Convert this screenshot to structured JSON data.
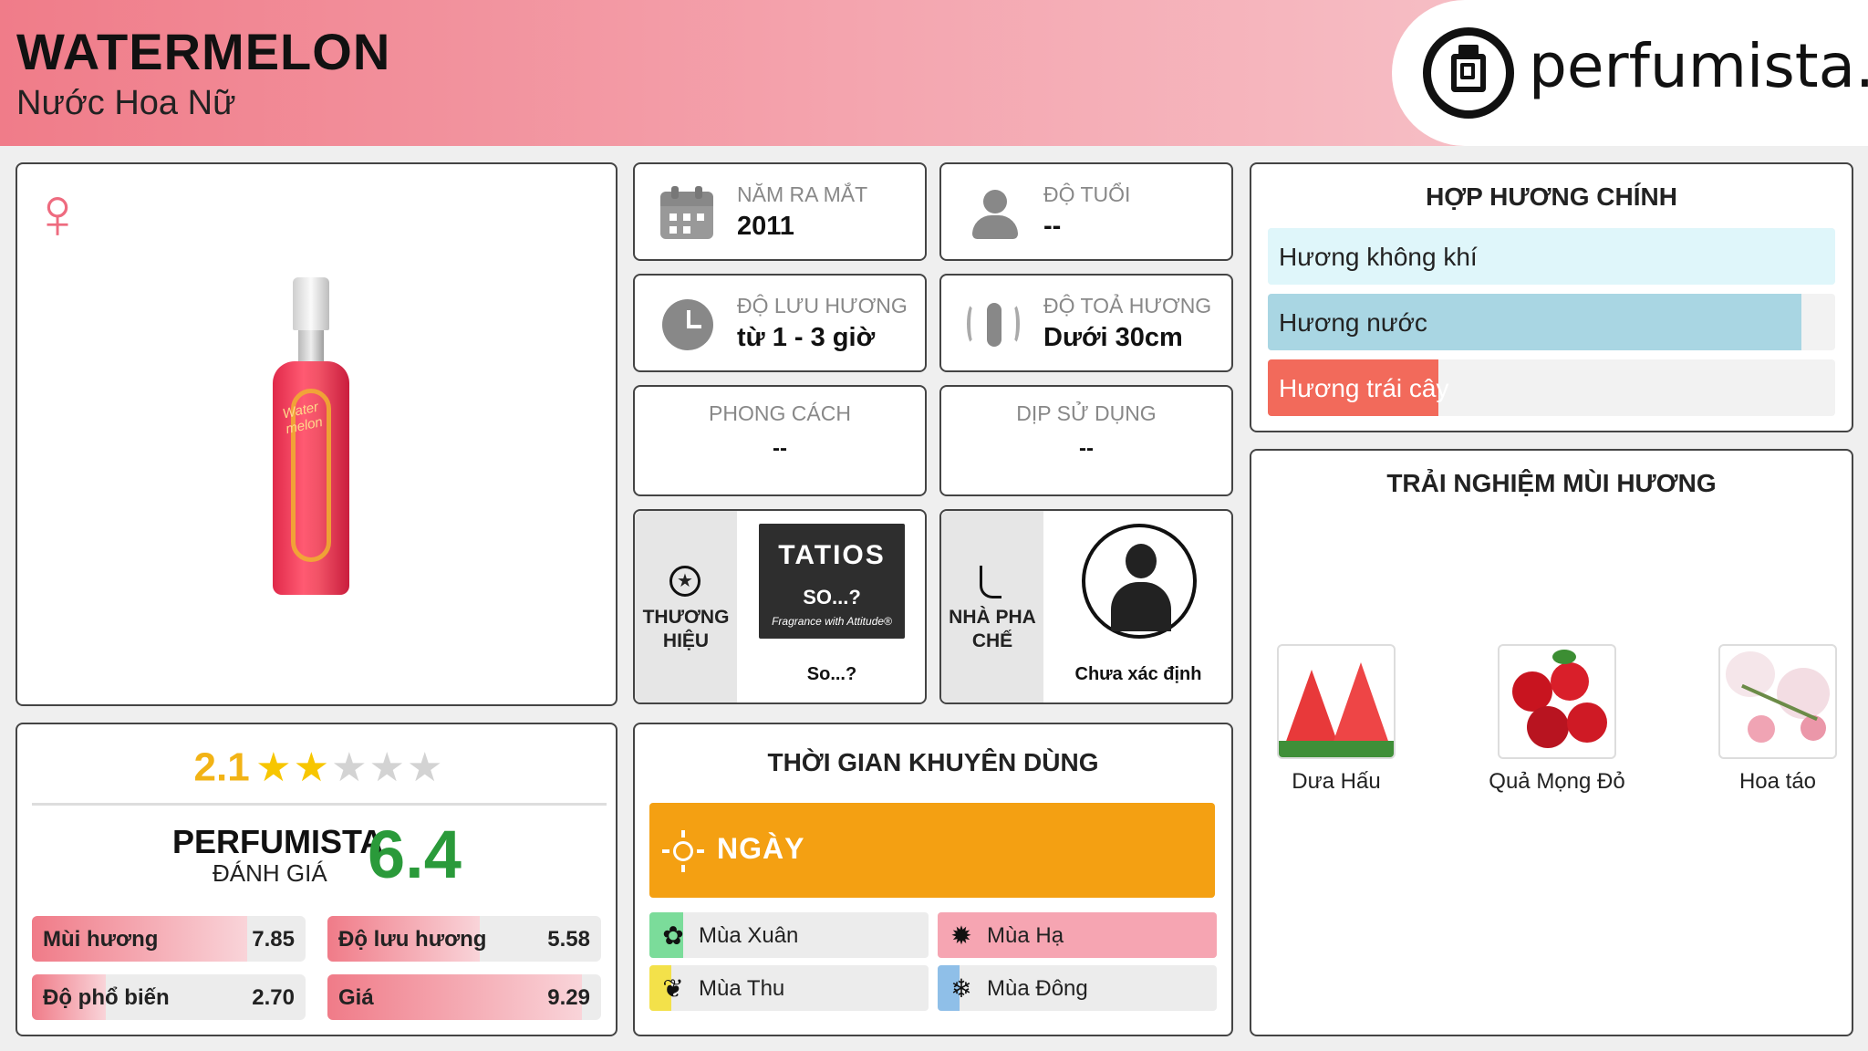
{
  "header": {
    "title": "WATERMELON",
    "subtitle": "Nước Hoa Nữ",
    "logo_text": "perfumista.vn"
  },
  "product": {
    "gender_icon": "venus-icon",
    "bottle_label": "Water melon"
  },
  "ratings": {
    "user_score": "2.1",
    "stars": [
      true,
      true,
      false,
      false,
      false
    ],
    "perfumista_label": "PERFUMISTA",
    "perfumista_sub": "ĐÁNH GIÁ",
    "perfumista_score": "6.4",
    "metrics": [
      {
        "label": "Mùi hương",
        "value": "7.85",
        "fraction": 0.785
      },
      {
        "label": "Độ lưu hương",
        "value": "5.58",
        "fraction": 0.558
      },
      {
        "label": "Độ phổ biến",
        "value": "2.70",
        "fraction": 0.27
      },
      {
        "label": "Giá",
        "value": "9.29",
        "fraction": 0.929
      }
    ]
  },
  "info": {
    "launch": {
      "label": "NĂM RA MẮT",
      "value": "2011",
      "icon": "calendar-icon"
    },
    "age": {
      "label": "ĐỘ TUỔI",
      "value": "--",
      "icon": "person-icon"
    },
    "longevity": {
      "label": "ĐỘ LƯU HƯƠNG",
      "value": "từ 1 - 3 giờ",
      "icon": "clock-icon"
    },
    "sillage": {
      "label": "ĐỘ TOẢ HƯƠNG",
      "value": "Dưới 30cm",
      "icon": "sillage-icon"
    },
    "style": {
      "label": "PHONG CÁCH",
      "value": "--"
    },
    "occasion": {
      "label": "DỊP SỬ DỤNG",
      "value": "--"
    }
  },
  "brand": {
    "side_label": "THƯƠNG HIỆU",
    "name": "So...?",
    "logo_text_top": "TATIOS",
    "logo_text_mid": "SO...?",
    "logo_text_bottom": "Fragrance with Attitude®"
  },
  "perfumer": {
    "side_label": "NHÀ PHA CHẾ",
    "name": "Chưa xác định"
  },
  "time_of_use": {
    "title": "THỜI GIAN KHUYÊN DÙNG",
    "day_label": "NGÀY",
    "seasons": [
      {
        "label": "Mùa Xuân",
        "icon": "flower-icon",
        "fraction": 0.12,
        "color": "#7bdc9a"
      },
      {
        "label": "Mùa Hạ",
        "icon": "sun-icon",
        "fraction": 1.0,
        "color": "#f6a5b2"
      },
      {
        "label": "Mùa Thu",
        "icon": "leaf-icon",
        "fraction": 0.08,
        "color": "#f3e14a"
      },
      {
        "label": "Mùa Đông",
        "icon": "snowflake-icon",
        "fraction": 0.08,
        "color": "#8fbfe8"
      }
    ]
  },
  "accords": {
    "title": "HỢP HƯƠNG CHÍNH",
    "items": [
      {
        "label": "Hương không khí",
        "fraction": 1.0,
        "color": "#dff6fa"
      },
      {
        "label": "Hương nước",
        "fraction": 0.94,
        "color": "#a9d6e3"
      },
      {
        "label": "Hương trái cây",
        "fraction": 0.3,
        "color": "#f26a5b"
      }
    ]
  },
  "notes": {
    "title": "TRẢI NGHIỆM MÙI HƯƠNG",
    "items": [
      {
        "label": "Dưa Hấu",
        "icon": "watermelon-icon"
      },
      {
        "label": "Quả Mọng Đỏ",
        "icon": "red-berries-icon"
      },
      {
        "label": "Hoa táo",
        "icon": "apple-blossom-icon"
      }
    ]
  }
}
